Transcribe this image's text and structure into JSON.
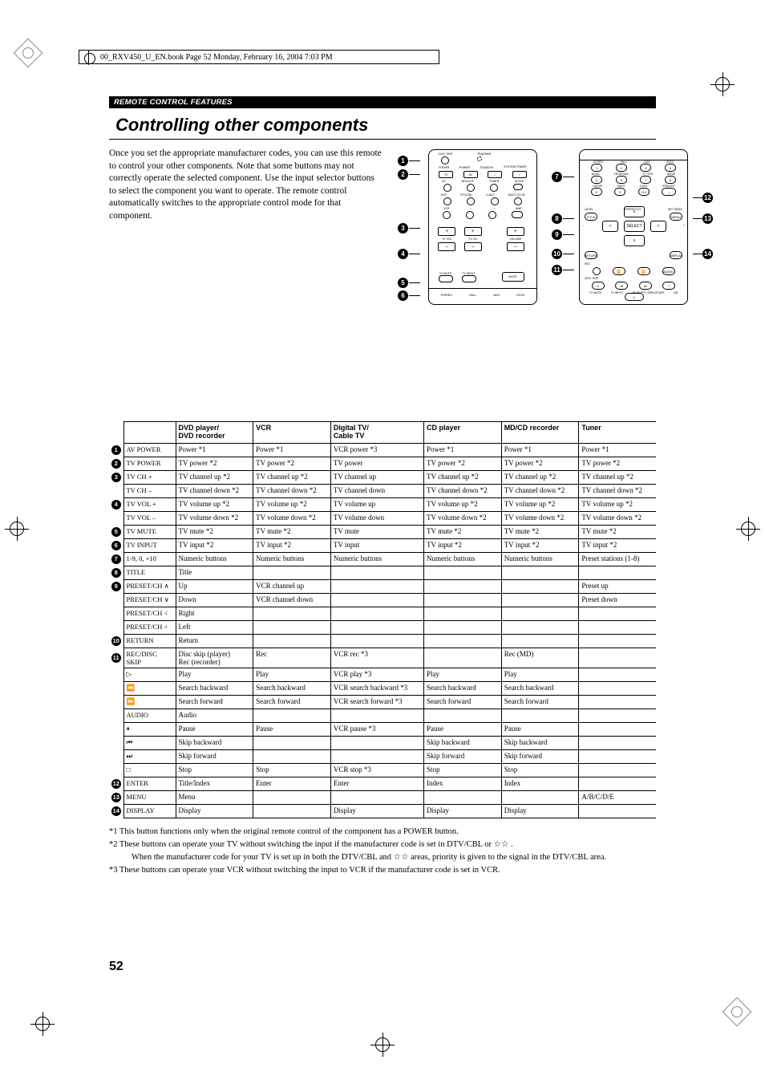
{
  "book_header": "00_RXV450_U_EN.book  Page 52  Monday, February 16, 2004  7:03 PM",
  "section_header": "REMOTE CONTROL FEATURES",
  "title": "Controlling other components",
  "intro": "Once you set the appropriate manufacturer codes, you can use this remote to control your other components. Note that some buttons may not correctly operate the selected component. Use the input selector buttons to select the component you want to operate. The remote control automatically switches to the appropriate control mode for that component.",
  "table": {
    "headers": [
      "",
      "",
      "DVD player/\nDVD recorder",
      "VCR",
      "Digital TV/\nCable TV",
      "CD player",
      "MD/CD recorder",
      "Tuner"
    ],
    "rows": [
      {
        "num": "1",
        "name": "AV POWER",
        "cells": [
          "Power *1",
          "Power *1",
          "VCR power *3",
          "Power *1",
          "Power *1",
          "Power *1"
        ]
      },
      {
        "num": "2",
        "name": "TV POWER",
        "cells": [
          "TV power *2",
          "TV power *2",
          "TV power",
          "TV power *2",
          "TV power *2",
          "TV power *2"
        ]
      },
      {
        "num": "3",
        "name": "TV CH +",
        "cells": [
          "TV channel up *2",
          "TV channel up *2",
          "TV channel up",
          "TV channel up *2",
          "TV channel up *2",
          "TV channel up *2"
        ]
      },
      {
        "num": "",
        "name": "TV CH –",
        "cells": [
          "TV channel down *2",
          "TV channel down *2",
          "TV channel down",
          "TV channel down *2",
          "TV channel down *2",
          "TV channel down *2"
        ]
      },
      {
        "num": "4",
        "name": "TV VOL +",
        "cells": [
          "TV volume up *2",
          "TV volume up *2",
          "TV volume up",
          "TV volume up *2",
          "TV volume up *2",
          "TV volume up *2"
        ]
      },
      {
        "num": "",
        "name": "TV VOL –",
        "cells": [
          "TV volume down *2",
          "TV volume down *2",
          "TV volume down",
          "TV volume down *2",
          "TV volume down *2",
          "TV volume down *2"
        ]
      },
      {
        "num": "5",
        "name": "TV MUTE",
        "cells": [
          "TV mute *2",
          "TV mute *2",
          "TV mute",
          "TV mute *2",
          "TV mute *2",
          "TV mute *2"
        ]
      },
      {
        "num": "6",
        "name": "TV INPUT",
        "cells": [
          "TV input *2",
          "TV input *2",
          "TV input",
          "TV input *2",
          "TV input *2",
          "TV input *2"
        ]
      },
      {
        "num": "7",
        "name": "1-9, 0, +10",
        "cells": [
          "Numeric buttons",
          "Numeric buttons",
          "Numeric buttons",
          "Numeric buttons",
          "Numeric buttons",
          "Preset stations (1-8)"
        ]
      },
      {
        "num": "8",
        "name": "TITLE",
        "cells": [
          "Title",
          "",
          "",
          "",
          "",
          ""
        ]
      },
      {
        "num": "9",
        "name": "PRESET/CH ∧",
        "cells": [
          "Up",
          "VCR channel up",
          "",
          "",
          "",
          "Preset up"
        ]
      },
      {
        "num": "",
        "name": "PRESET/CH ∨",
        "cells": [
          "Down",
          "VCR channel down",
          "",
          "",
          "",
          "Preset down"
        ]
      },
      {
        "num": "",
        "name": "PRESET/CH <",
        "cells": [
          "Right",
          "",
          "",
          "",
          "",
          ""
        ]
      },
      {
        "num": "",
        "name": "PRESET/CH >",
        "cells": [
          "Left",
          "",
          "",
          "",
          "",
          ""
        ]
      },
      {
        "num": "10",
        "name": "RETURN",
        "cells": [
          "Return",
          "",
          "",
          "",
          "",
          ""
        ]
      },
      {
        "num": "11",
        "name": "REC/DISC SKIP",
        "cells": [
          "Disc skip (player)\nRec (recorder)",
          "Rec",
          "VCR rec *3",
          "",
          "Rec (MD)",
          ""
        ]
      },
      {
        "num": "",
        "name": "▷",
        "cells": [
          "Play",
          "Play",
          "VCR play *3",
          "Play",
          "Play",
          ""
        ]
      },
      {
        "num": "",
        "name": "⏪",
        "cells": [
          "Search backward",
          "Search backward",
          "VCR search backward *3",
          "Search backward",
          "Search backward",
          ""
        ]
      },
      {
        "num": "",
        "name": "⏩",
        "cells": [
          "Search forward",
          "Search forward",
          "VCR search forward *3",
          "Search forward",
          "Search forward",
          ""
        ]
      },
      {
        "num": "",
        "name": "AUDIO",
        "cells": [
          "Audio",
          "",
          "",
          "",
          "",
          ""
        ]
      },
      {
        "num": "",
        "name": "⏸",
        "cells": [
          "Pause",
          "Pause",
          "VCR pause *3",
          "Pause",
          "Pause",
          ""
        ]
      },
      {
        "num": "",
        "name": "⏮",
        "cells": [
          "Skip backward",
          "",
          "",
          "Skip backward",
          "Skip backward",
          ""
        ]
      },
      {
        "num": "",
        "name": "⏭",
        "cells": [
          "Skip forward",
          "",
          "",
          "Skip forward",
          "Skip forward",
          ""
        ]
      },
      {
        "num": "",
        "name": "□",
        "cells": [
          "Stop",
          "Stop",
          "VCR stop *3",
          "Stop",
          "Stop",
          ""
        ]
      },
      {
        "num": "12",
        "name": "ENTER",
        "cells": [
          "Title/Index",
          "Enter",
          "Enter",
          "Index",
          "Index",
          ""
        ]
      },
      {
        "num": "13",
        "name": "MENU",
        "cells": [
          "Menu",
          "",
          "",
          "",
          "",
          "A/B/C/D/E"
        ]
      },
      {
        "num": "14",
        "name": "DISPLAY",
        "cells": [
          "Display",
          "",
          "Display",
          "Display",
          "Display",
          ""
        ]
      }
    ]
  },
  "notes": {
    "n1": "*1 This button functions only when the original remote control of the component has a POWER button.",
    "n2": "*2 These buttons can operate your TV without switching the input if the manufacturer code is set in DTV/CBL or  ☆☆ .",
    "n2b": "When the manufacturer code for your TV is set up in both the DTV/CBL and  ☆☆  areas, priority is given to the signal in the DTV/CBL area.",
    "n3": "*3 These buttons can operate your VCR without switching the input to VCR if the manufacturer code is set in VCR."
  },
  "pagenum": "52",
  "left_remote": {
    "row1": {
      "labels": [
        "DISC SKIP",
        "",
        "TRANSMIT"
      ]
    },
    "row2": [
      "POWER",
      "POWER",
      "STAND BY",
      "SYSTEM POWER"
    ],
    "row3": [
      "TV",
      "AV",
      "☆",
      "!"
    ],
    "row4_labels": [
      "CD",
      "MD/CD-R",
      "TUNER",
      "SLEEP"
    ],
    "row5_labels": [
      "DVD",
      "DTV/CBL",
      "V-AUX",
      "MULTI CH IN"
    ],
    "row6_labels": [
      "VCR",
      "☆",
      "☆☆",
      "",
      "AMP"
    ],
    "vols": [
      {
        "top": "+",
        "mid": "TV VOL",
        "bot": "–"
      },
      {
        "top": "+",
        "mid": "TV CH",
        "bot": "–"
      },
      {
        "top": "+",
        "mid": "VOLUME",
        "bot": "–"
      }
    ],
    "tvmute": "TV MUTE",
    "tvinput": "TV INPUT",
    "mute": "MUTE",
    "program_labels": [
      "STEREO",
      "HALL",
      "JAZZ",
      "ROCK"
    ]
  },
  "right_remote": {
    "grid_labels": [
      [
        "STEREO",
        "HALL",
        "JAZZ",
        "ROCK"
      ],
      [
        "MUSIC",
        "ENTERTAIN",
        "TV THTR",
        "MOVIE"
      ],
      [
        "☆MOVIE",
        "NIGHT",
        "6.1/ES",
        "STRAIGHT"
      ]
    ],
    "grid_values": [
      [
        "1",
        "2",
        "3",
        "4"
      ],
      [
        "5",
        "6",
        "7",
        "8"
      ],
      [
        "9",
        "0",
        "+10",
        "—"
      ]
    ],
    "title": "TITLE",
    "menu": "MENU",
    "select": "SELECT",
    "level": "LEVEL",
    "preset_ch": "PRESET/CH",
    "setmenu": "SET MENU",
    "return": "RETURN",
    "display": "DISPLAY",
    "rec": "REC",
    "disc_skip": "DISC SKIP",
    "audio": "AUDIO",
    "bottom_labels": [
      "TV MUTE",
      "TV INPUT",
      "MUTE/PTY SEEK/START",
      "ON"
    ]
  },
  "callouts_left": [
    "1",
    "2",
    "3",
    "4",
    "5",
    "6"
  ],
  "callouts_right": [
    "7",
    "8",
    "9",
    "10",
    "11",
    "12",
    "13",
    "14"
  ]
}
